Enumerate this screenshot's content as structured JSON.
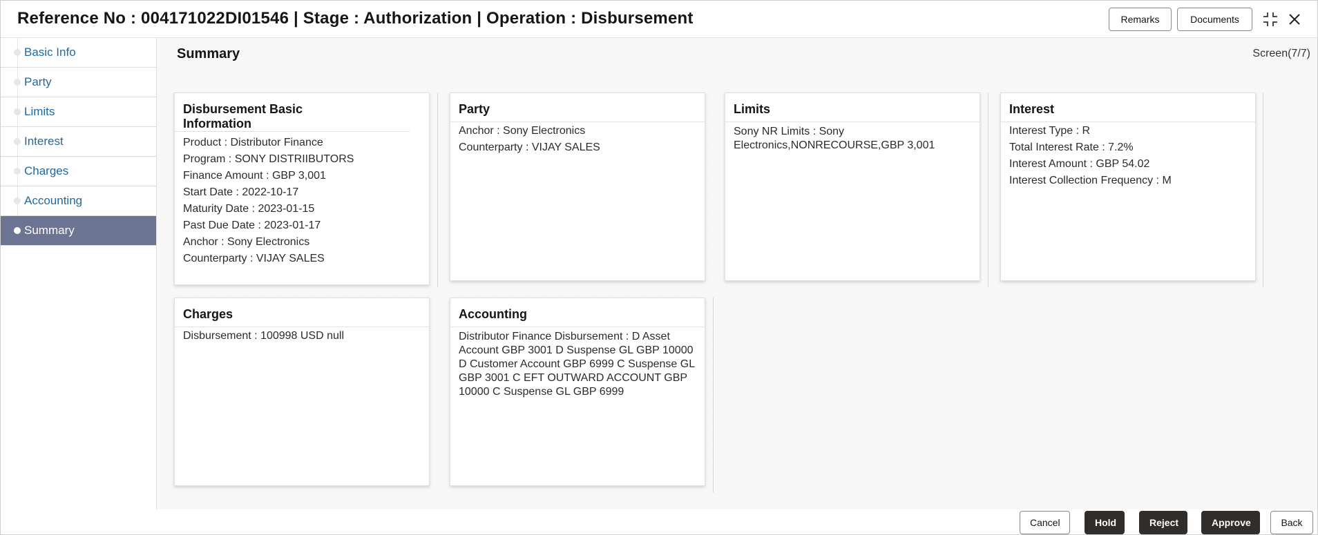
{
  "header": {
    "title": "Reference No : 004171022DI01546 | Stage : Authorization | Operation : Disbursement",
    "remarks_label": "Remarks",
    "documents_label": "Documents"
  },
  "sidebar": {
    "items": [
      {
        "label": "Basic Info",
        "active": false
      },
      {
        "label": "Party",
        "active": false
      },
      {
        "label": "Limits",
        "active": false
      },
      {
        "label": "Interest",
        "active": false
      },
      {
        "label": "Charges",
        "active": false
      },
      {
        "label": "Accounting",
        "active": false
      },
      {
        "label": "Summary",
        "active": true
      }
    ]
  },
  "main": {
    "title": "Summary",
    "screen_count": "Screen(7/7)",
    "cards": {
      "basic": {
        "title": "Disbursement Basic Information",
        "lines": [
          "Product : Distributor Finance",
          "Program : SONY DISTRIIBUTORS",
          "Finance Amount : GBP 3,001",
          "Start Date : 2022-10-17",
          "Maturity Date : 2023-01-15",
          "Past Due Date : 2023-01-17",
          "Anchor : Sony Electronics",
          "Counterparty : VIJAY SALES"
        ]
      },
      "party": {
        "title": "Party",
        "lines": [
          "Anchor : Sony Electronics",
          "Counterparty : VIJAY SALES"
        ]
      },
      "limits": {
        "title": "Limits",
        "text": "Sony NR Limits : Sony Electronics,NONRECOURSE,GBP 3,001"
      },
      "interest": {
        "title": "Interest",
        "lines": [
          "Interest Type : R",
          "Total Interest Rate : 7.2%",
          "Interest Amount : GBP 54.02",
          "Interest Collection Frequency : M"
        ]
      },
      "charges": {
        "title": "Charges",
        "lines": [
          "Disbursement : 100998 USD null"
        ]
      },
      "accounting": {
        "title": "Accounting",
        "text": "Distributor Finance Disbursement : D Asset Account GBP 3001 D Suspense GL GBP 10000 D Customer Account GBP 6999 C Suspense GL GBP 3001 C EFT OUTWARD ACCOUNT GBP 10000 C Suspense GL GBP 6999"
      }
    }
  },
  "footer": {
    "cancel_label": "Cancel",
    "hold_label": "Hold",
    "reject_label": "Reject",
    "approve_label": "Approve",
    "back_label": "Back"
  },
  "colors": {
    "sidebar_active_bg": "#6b7593",
    "nav_link": "#1e6aa0",
    "primary_button": "#312d2a"
  }
}
